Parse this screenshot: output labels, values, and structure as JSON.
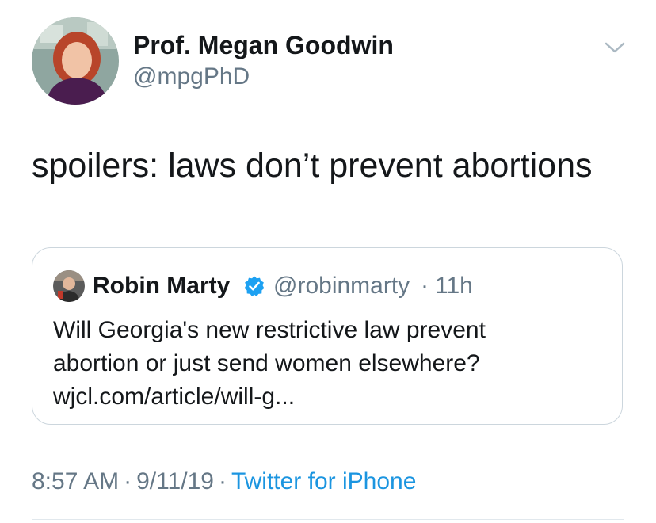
{
  "author": {
    "display_name": "Prof. Megan Goodwin",
    "handle": "@mpgPhD",
    "avatar": "user-avatar-photo"
  },
  "menu": {
    "icon": "chevron-down-icon"
  },
  "tweet": {
    "text": "spoilers: laws don’t prevent abortions"
  },
  "quoted_tweet": {
    "display_name": "Robin Marty",
    "verified_icon": "verified-badge-icon",
    "handle": "@robinmarty",
    "separator": "·",
    "time": "11h",
    "text_lines": [
      "Will Georgia's new restrictive law prevent",
      "abortion or just send women elsewhere?"
    ],
    "link": "wjcl.com/article/will-g..."
  },
  "meta": {
    "time": "8:57 AM",
    "separator": "·",
    "date": "9/11/19",
    "source": "Twitter for iPhone"
  },
  "colors": {
    "text": "#14171a",
    "secondary": "#657786",
    "link": "#1b95e0",
    "verified": "#1da1f2",
    "border": "#ccd6dd"
  }
}
